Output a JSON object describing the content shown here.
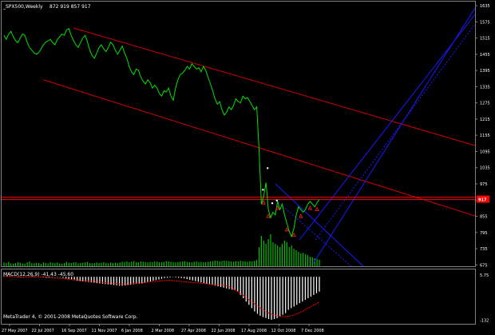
{
  "header": {
    "symbol_label": "_SPX500,Weekly",
    "ohlc_label": "872 919 857 917"
  },
  "macd_label": "MACD(12,26,9) -41.43  -45.60",
  "footer": {
    "line1": "MetaTrader 4, © 2001-2008 MetaQuotes Software Corp.",
    "line2": ""
  },
  "colors": {
    "background": "#000000",
    "price_line": "#00e000",
    "volume": "#00c000",
    "channel_line": "#d00000",
    "blue_line": "#1a1aff",
    "level_line": "#ff0000",
    "price_tag": "#ff0000",
    "axis_text": "#ffffff",
    "macd_hist": "#ffffff",
    "macd_signal": "#ff0000",
    "arrow_marker": "#ff2020",
    "dot_marker": "#ffffff"
  },
  "chart_data": {
    "type": "line",
    "title": "",
    "ylim": [
      670,
      1650
    ],
    "y_ticks": [
      1635,
      1575,
      1515,
      1455,
      1395,
      1335,
      1275,
      1215,
      1155,
      1095,
      1035,
      975,
      915,
      855,
      795,
      735,
      675
    ],
    "x_ticks": [
      "27 May 2007",
      "22 Jul 2007",
      "16 Sep 2007",
      "11 Nov 2007",
      "6 Jan 2008",
      "2 Mar 2008",
      "27 Apr 2008",
      "22 Jun 2008",
      "17 Aug 2008",
      "12 Oct 2008",
      "7 Dec 2008"
    ],
    "current_price": 917,
    "current_price_label": "917",
    "series": [
      {
        "values": [
          1525,
          1510,
          1530,
          1540,
          1520,
          1505,
          1498,
          1515,
          1530,
          1525,
          1500,
          1480,
          1470,
          1460,
          1455,
          1462,
          1475,
          1490,
          1500,
          1505,
          1510,
          1498,
          1490,
          1510,
          1520,
          1530,
          1525,
          1545,
          1550,
          1525,
          1505,
          1490,
          1480,
          1498,
          1515,
          1525,
          1500,
          1470,
          1450,
          1440,
          1460,
          1480,
          1490,
          1475,
          1465,
          1480,
          1500,
          1490,
          1470,
          1455,
          1470,
          1485,
          1460,
          1440,
          1410,
          1390,
          1380,
          1400,
          1395,
          1370,
          1355,
          1345,
          1360,
          1350,
          1330,
          1340,
          1330,
          1310,
          1300,
          1320,
          1315,
          1330,
          1300,
          1285,
          1330,
          1360,
          1380,
          1385,
          1395,
          1410,
          1400,
          1420,
          1410,
          1400,
          1405,
          1390,
          1410,
          1395,
          1370,
          1345,
          1320,
          1290,
          1270,
          1280,
          1250,
          1230,
          1240,
          1260,
          1250,
          1265,
          1290,
          1280,
          1275,
          1300,
          1290,
          1295,
          1280,
          1265,
          1250,
          1260,
          1100,
          900,
          930,
          980,
          880,
          850,
          870,
          860,
          910,
          880,
          900,
          860,
          830,
          800,
          780,
          810,
          860,
          890,
          880,
          870,
          880,
          900,
          910,
          900,
          890,
          905,
          917
        ]
      }
    ],
    "volume": [
      0.12,
      0.1,
      0.14,
      0.09,
      0.08,
      0.1,
      0.13,
      0.11,
      0.09,
      0.08,
      0.12,
      0.15,
      0.1,
      0.09,
      0.11,
      0.1,
      0.08,
      0.12,
      0.1,
      0.09,
      0.13,
      0.11,
      0.1,
      0.12,
      0.09,
      0.08,
      0.1,
      0.14,
      0.11,
      0.1,
      0.12,
      0.13,
      0.09,
      0.1,
      0.11,
      0.12,
      0.14,
      0.1,
      0.09,
      0.1,
      0.12,
      0.1,
      0.11,
      0.13,
      0.1,
      0.09,
      0.12,
      0.1,
      0.11,
      0.1,
      0.12,
      0.14,
      0.13,
      0.15,
      0.12,
      0.14,
      0.16,
      0.13,
      0.12,
      0.15,
      0.14,
      0.13,
      0.12,
      0.14,
      0.13,
      0.15,
      0.14,
      0.12,
      0.13,
      0.14,
      0.16,
      0.15,
      0.14,
      0.13,
      0.12,
      0.13,
      0.14,
      0.15,
      0.16,
      0.14,
      0.13,
      0.12,
      0.14,
      0.15,
      0.13,
      0.14,
      0.12,
      0.13,
      0.14,
      0.15,
      0.16,
      0.18,
      0.17,
      0.15,
      0.16,
      0.18,
      0.17,
      0.16,
      0.15,
      0.14,
      0.16,
      0.15,
      0.17,
      0.16,
      0.15,
      0.14,
      0.16,
      0.15,
      0.17,
      0.2,
      0.6,
      0.95,
      0.8,
      0.7,
      0.85,
      1.0,
      0.75,
      0.7,
      0.65,
      0.6,
      0.7,
      0.8,
      0.75,
      0.6,
      0.65,
      0.55,
      0.5,
      0.45,
      0.4,
      0.42,
      0.38,
      0.35,
      0.3,
      0.28,
      0.25,
      0.22,
      0.2
    ],
    "macd": {
      "ylim": [
        -140,
        15
      ],
      "y_ticks": [
        5.75,
        -132
      ],
      "y_tick_labels": [
        "5.75",
        "-132"
      ],
      "hist": [
        2,
        3,
        2,
        1,
        0,
        -1,
        -2,
        -1,
        0,
        1,
        2,
        1,
        0,
        -1,
        -2,
        -3,
        -2,
        -1,
        0,
        1,
        -1,
        -3,
        -5,
        -7,
        -9,
        -10,
        -12,
        -13,
        -14,
        -15,
        -16,
        -17,
        -18,
        -19,
        -20,
        -21,
        -22,
        -23,
        -24,
        -25,
        -26,
        -27,
        -27,
        -26,
        -25,
        -24,
        -23,
        -22,
        -21,
        -20,
        -18,
        -16,
        -14,
        -12,
        -10,
        -8,
        -6,
        -4,
        -3,
        -2,
        -1,
        -2,
        -3,
        -4,
        -5,
        -7,
        -9,
        -11,
        -13,
        -15,
        -17,
        -19,
        -21,
        -23,
        -25,
        -27,
        -29,
        -31,
        -33,
        -35,
        -37,
        -39,
        -41,
        -45,
        -55,
        -65,
        -75,
        -85,
        -95,
        -105,
        -112,
        -118,
        -122,
        -125,
        -128,
        -130,
        -128,
        -125,
        -120,
        -115,
        -110,
        -100,
        -95,
        -90,
        -85,
        -80,
        -75,
        -70,
        -65,
        -60,
        -55,
        -50,
        -45
      ],
      "signal": [
        1,
        1,
        1,
        0,
        0,
        -1,
        -1,
        -1,
        0,
        0,
        0,
        0,
        -1,
        -2,
        -3,
        -4,
        -5,
        -6,
        -7,
        -8,
        -9,
        -10,
        -11,
        -12,
        -13,
        -14,
        -15,
        -16,
        -17,
        -18,
        -19,
        -20,
        -21,
        -22,
        -22,
        -22,
        -21,
        -20,
        -19,
        -18,
        -17,
        -16,
        -15,
        -14,
        -13,
        -12,
        -11,
        -11,
        -12,
        -13,
        -14,
        -15,
        -16,
        -17,
        -18,
        -19,
        -20,
        -21,
        -22,
        -23,
        -24,
        -25,
        -26,
        -28,
        -32,
        -38,
        -45,
        -52,
        -60,
        -68,
        -76,
        -84,
        -92,
        -100,
        -106,
        -111,
        -115,
        -118,
        -120,
        -121,
        -120,
        -118,
        -115,
        -111,
        -106,
        -100,
        -94,
        -88,
        -82,
        -76
      ]
    }
  }
}
